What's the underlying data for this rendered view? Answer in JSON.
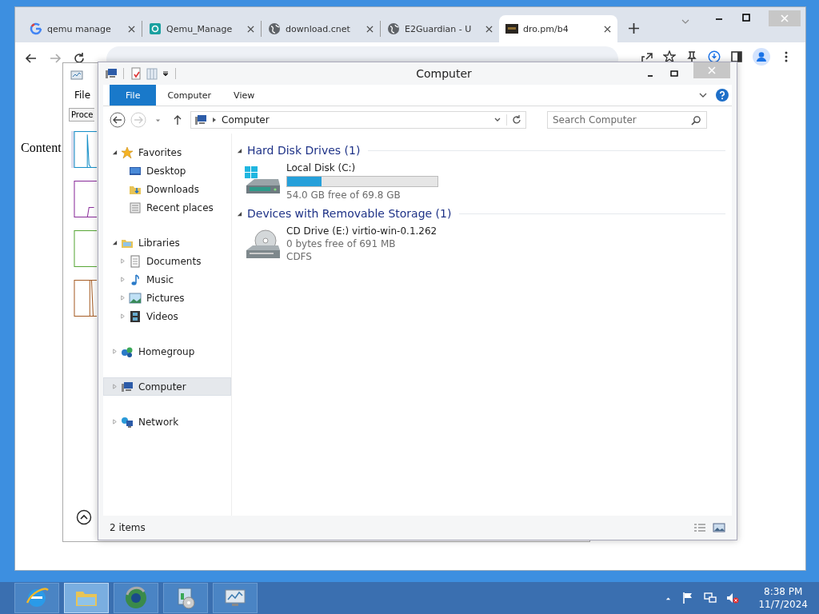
{
  "browser": {
    "tabs": [
      {
        "title": "qemu manage",
        "kind": "google",
        "selected": false
      },
      {
        "title": "Qemu_Manage",
        "kind": "gear",
        "selected": false
      },
      {
        "title": "download.cnet",
        "kind": "globe",
        "selected": false
      },
      {
        "title": "E2Guardian - U",
        "kind": "globe",
        "selected": false
      },
      {
        "title": "dro.pm/b4",
        "kind": "dark",
        "selected": true
      }
    ],
    "page_text": "Content"
  },
  "background_window": {
    "menu": "File",
    "tab": "Proce"
  },
  "explorer": {
    "title": "Computer",
    "ribbon_tabs": [
      {
        "label": "File",
        "kind": "app_menu"
      },
      {
        "label": "Computer",
        "kind": "tab"
      },
      {
        "label": "View",
        "kind": "tab"
      }
    ],
    "path": "Computer",
    "search": {
      "placeholder": "Search Computer"
    },
    "nav": [
      {
        "label": "Favorites",
        "kind": "star",
        "expanded": true,
        "selected": false,
        "children": [
          {
            "label": "Desktop",
            "kind": "desktop",
            "selected": false
          },
          {
            "label": "Downloads",
            "kind": "downloads",
            "selected": false
          },
          {
            "label": "Recent places",
            "kind": "recent",
            "selected": false
          }
        ]
      },
      {
        "label": "Libraries",
        "kind": "libraries",
        "expanded": true,
        "selected": false,
        "children": [
          {
            "label": "Documents",
            "kind": "documents",
            "expanded": false,
            "selected": false
          },
          {
            "label": "Music",
            "kind": "music",
            "expanded": false,
            "selected": false
          },
          {
            "label": "Pictures",
            "kind": "pictures",
            "expanded": false,
            "selected": false
          },
          {
            "label": "Videos",
            "kind": "videos",
            "expanded": false,
            "selected": false
          }
        ]
      },
      {
        "label": "Homegroup",
        "kind": "homegroup",
        "expanded": false,
        "selected": false
      },
      {
        "label": "Computer",
        "kind": "computer",
        "expanded": false,
        "selected": true
      },
      {
        "label": "Network",
        "kind": "network",
        "expanded": false,
        "selected": false
      }
    ],
    "sections": [
      {
        "heading": "Hard Disk Drives (1)",
        "items": [
          {
            "name": "Local Disk (C:)",
            "kind": "disk",
            "level": 0.23,
            "lines": [
              "54.0 GB free of 69.8 GB"
            ]
          }
        ]
      },
      {
        "heading": "Devices with Removable Storage (1)",
        "items": [
          {
            "name": "CD Drive (E:) virtio-win-0.1.262",
            "kind": "cd",
            "lines": [
              "0 bytes free of 691 MB",
              "CDFS"
            ]
          }
        ]
      }
    ],
    "status": "2 items"
  },
  "taskbar": {
    "apps": [
      {
        "kind": "ie",
        "active": false
      },
      {
        "kind": "explorer",
        "active": true
      },
      {
        "kind": "chrome",
        "active": false
      },
      {
        "kind": "installer",
        "active": false
      },
      {
        "kind": "taskmgr",
        "active": false
      }
    ],
    "time": "8:38 PM",
    "date": "11/7/2024"
  }
}
